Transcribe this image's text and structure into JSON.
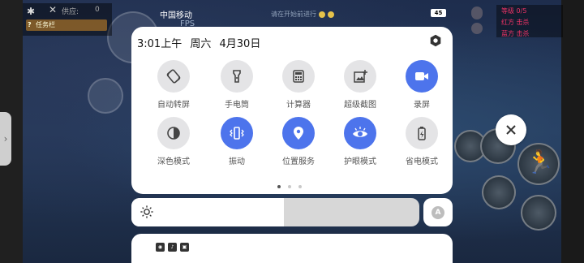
{
  "status_bar": {
    "carrier": "中国移动",
    "battery": "45"
  },
  "game_hud": {
    "top_left_label": "供应:",
    "top_left_value": "0",
    "badge_text": "任务栏",
    "badge_marker": "?",
    "fps_label": "FPS",
    "mid_status": "请在开始前进行",
    "right_panel_rows": [
      "等级 0/5",
      "红方 击杀",
      "蓝方 击杀"
    ]
  },
  "control_center": {
    "time": "3:01上午",
    "weekday": "周六",
    "date": "4月30日",
    "tiles": [
      {
        "label": "自动转屏",
        "icon": "auto-rotate-icon",
        "active": false
      },
      {
        "label": "手电筒",
        "icon": "flashlight-icon",
        "active": false
      },
      {
        "label": "计算器",
        "icon": "calculator-icon",
        "active": false
      },
      {
        "label": "超级截图",
        "icon": "screenshot-icon",
        "active": false
      },
      {
        "label": "录屏",
        "icon": "screen-record-icon",
        "active": true
      },
      {
        "label": "深色模式",
        "icon": "dark-mode-icon",
        "active": false
      },
      {
        "label": "振动",
        "icon": "vibrate-icon",
        "active": true
      },
      {
        "label": "位置服务",
        "icon": "location-icon",
        "active": true
      },
      {
        "label": "护眼模式",
        "icon": "eye-comfort-icon",
        "active": true
      },
      {
        "label": "省电模式",
        "icon": "battery-saver-icon",
        "active": false
      }
    ],
    "page_count": 3,
    "current_page": 1
  },
  "brightness": {
    "level": 0.53,
    "auto_label": "A"
  },
  "colors": {
    "accent": "#4d74ec",
    "tile_inactive": "#e4e4e6",
    "panel_bg": "#ffffff"
  }
}
